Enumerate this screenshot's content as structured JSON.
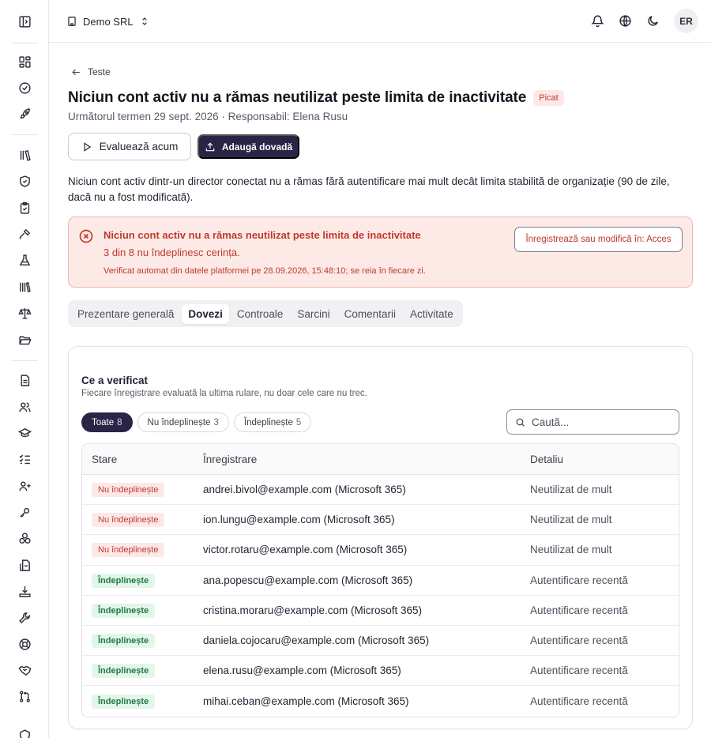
{
  "org": {
    "name": "Demo SRL"
  },
  "user": {
    "initials": "ER"
  },
  "back": {
    "label": "Teste"
  },
  "test": {
    "title": "Niciun cont activ nu a rămas neutilizat peste limita de inactivitate",
    "status": "Picat",
    "meta": "Următorul termen 29 sept. 2026 · Responsabil: Elena Rusu",
    "evaluate_label": "Evaluează acum",
    "add_evidence_label": "Adaugă dovadă",
    "description": "Niciun cont activ dintr-un director conectat nu a rămas fără autentificare mai mult decât limita stabilită de organizație (90 de zile, dacă nu a fost modificată)."
  },
  "alert": {
    "title": "Niciun cont activ nu a rămas neutilizat peste limita de inactivitate",
    "summary": "3 din 8 nu îndeplinesc cerința.",
    "note": "Verificat automat din datele platformei pe 28.09.2026, 15:48:10; se reia în fiecare zi.",
    "action_label": "Înregistrează sau modifică în: Acces"
  },
  "tabs": [
    {
      "label": "Prezentare generală",
      "active": false
    },
    {
      "label": "Dovezi",
      "active": true
    },
    {
      "label": "Controale",
      "active": false
    },
    {
      "label": "Sarcini",
      "active": false
    },
    {
      "label": "Comentarii",
      "active": false
    },
    {
      "label": "Activitate",
      "active": false
    }
  ],
  "card": {
    "title": "Ce a verificat",
    "subtitle": "Fiecare înregistrare evaluată la ultima rulare, nu doar cele care nu trec.",
    "filters": [
      {
        "label": "Toate",
        "count": "8",
        "active": true
      },
      {
        "label": "Nu îndeplinește",
        "count": "3",
        "active": false
      },
      {
        "label": "Îndeplinește",
        "count": "5",
        "active": false
      }
    ],
    "search_placeholder": "Caută...",
    "columns": {
      "status": "Stare",
      "record": "Înregistrare",
      "detail": "Detaliu"
    },
    "rows": [
      {
        "status": "Nu îndeplinește",
        "type": "fail",
        "record": "andrei.bivol@example.com (Microsoft 365)",
        "detail": "Neutilizat de mult"
      },
      {
        "status": "Nu îndeplinește",
        "type": "fail",
        "record": "ion.lungu@example.com (Microsoft 365)",
        "detail": "Neutilizat de mult"
      },
      {
        "status": "Nu îndeplinește",
        "type": "fail",
        "record": "victor.rotaru@example.com (Microsoft 365)",
        "detail": "Neutilizat de mult"
      },
      {
        "status": "Îndeplinește",
        "type": "pass",
        "record": "ana.popescu@example.com (Microsoft 365)",
        "detail": "Autentificare recentă"
      },
      {
        "status": "Îndeplinește",
        "type": "pass",
        "record": "cristina.moraru@example.com (Microsoft 365)",
        "detail": "Autentificare recentă"
      },
      {
        "status": "Îndeplinește",
        "type": "pass",
        "record": "daniela.cojocaru@example.com (Microsoft 365)",
        "detail": "Autentificare recentă"
      },
      {
        "status": "Îndeplinește",
        "type": "pass",
        "record": "elena.rusu@example.com (Microsoft 365)",
        "detail": "Autentificare recentă"
      },
      {
        "status": "Îndeplinește",
        "type": "pass",
        "record": "mihai.ceban@example.com (Microsoft 365)",
        "detail": "Autentificare recentă"
      }
    ]
  },
  "colors": {
    "accent": "#2a2547",
    "fail": "#c0392b",
    "fail_bg": "#fdeae7",
    "pass": "#1e7a44",
    "pass_bg": "#e3f6ea"
  }
}
